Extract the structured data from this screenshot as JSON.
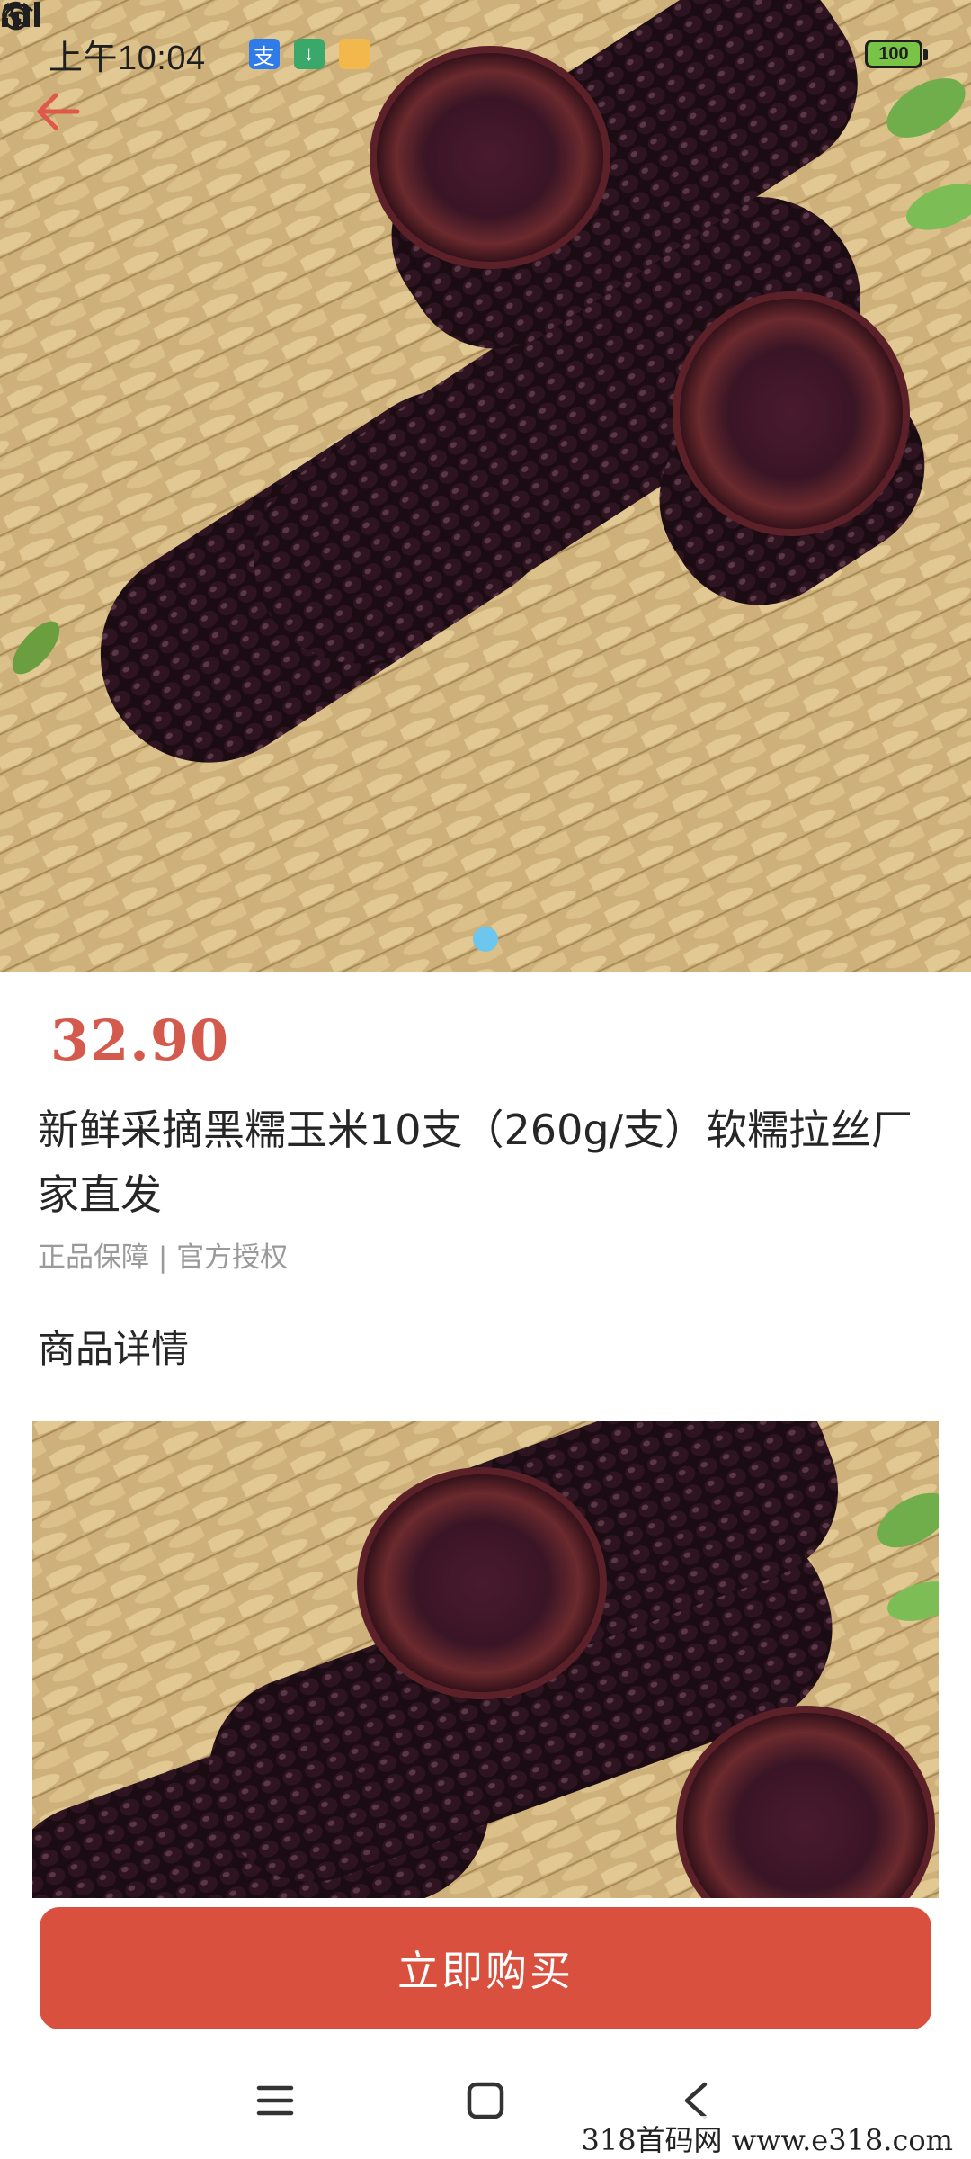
{
  "status_bar": {
    "time": "上午10:04",
    "battery": "100",
    "colors": {
      "alipay": "#2f7be8",
      "download": "#3aa86b",
      "folder": "#f2b84b"
    }
  },
  "product": {
    "price": "32.90",
    "title": "新鲜采摘黑糯玉米10支（260g/支）软糯拉丝厂家直发",
    "guarantee": "正品保障 | 官方授权",
    "details_heading": "商品详情"
  },
  "carousel": {
    "current": 1,
    "total": 1
  },
  "actions": {
    "buy_label": "立即购买"
  },
  "colors": {
    "accent": "#d9503f",
    "price": "#d45a4e",
    "back_arrow": "#e0584a",
    "carousel_dot": "#6cc6ee"
  },
  "icons": {
    "back": "arrow-left-icon",
    "dnd": "moon-icon",
    "alarm": "alarm-clock-icon",
    "alipay": "alipay-icon",
    "download": "download-icon",
    "folder": "folder-icon",
    "nav_menu": "menu-icon",
    "nav_home": "square-home-icon",
    "nav_back": "chevron-left-icon"
  },
  "watermark": "318首码网  www.e318.com"
}
